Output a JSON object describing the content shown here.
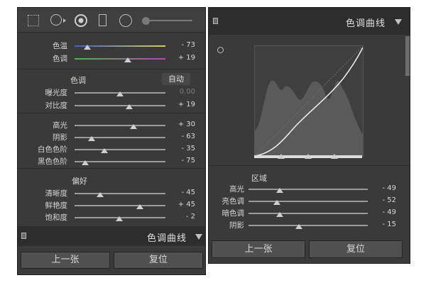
{
  "left_panel": {
    "wb_sliders": [
      {
        "label": "色温",
        "value": "- 73",
        "level": 0.18
      },
      {
        "label": "色调",
        "value": "+ 19",
        "level": 0.61
      }
    ],
    "tone": {
      "title": "色调",
      "auto_label": "自动",
      "sliders": [
        {
          "label": "曝光度",
          "value": "0.00",
          "level": 0.5,
          "dim": true
        },
        {
          "label": "对比度",
          "value": "+ 19",
          "level": 0.6
        },
        {
          "label": "高光",
          "value": "+ 30",
          "level": 0.65
        },
        {
          "label": "阴影",
          "value": "- 63",
          "level": 0.19
        },
        {
          "label": "白色色阶",
          "value": "- 35",
          "level": 0.33
        },
        {
          "label": "黑色色阶",
          "value": "- 75",
          "level": 0.12
        }
      ]
    },
    "presence": {
      "title": "偏好",
      "sliders": [
        {
          "label": "清晰度",
          "value": "- 45",
          "level": 0.28
        },
        {
          "label": "鲜艳度",
          "value": "+ 45",
          "level": 0.72
        },
        {
          "label": "饱和度",
          "value": "- 2",
          "level": 0.49
        }
      ]
    },
    "section_title": "色调曲线",
    "prev_button": "上一张",
    "reset_button": "复位"
  },
  "right_panel": {
    "section_title": "色调曲线",
    "region_title": "区域",
    "sliders": [
      {
        "label": "高光",
        "value": "- 49",
        "level": 0.26
      },
      {
        "label": "亮色调",
        "value": "- 52",
        "level": 0.24
      },
      {
        "label": "暗色调",
        "value": "- 49",
        "level": 0.26
      },
      {
        "label": "阴影",
        "value": "- 15",
        "level": 0.42
      }
    ],
    "prev_button": "上一张",
    "reset_button": "复位"
  },
  "colors": {
    "panel_bg": "#3a3a3a",
    "header_bg": "#2d2d2d",
    "button_bg": "#505050",
    "temp_track": [
      "#3b5fd4",
      "#d6d24a"
    ],
    "tint_track": [
      "#3fbf3f",
      "#c13fc1"
    ]
  }
}
